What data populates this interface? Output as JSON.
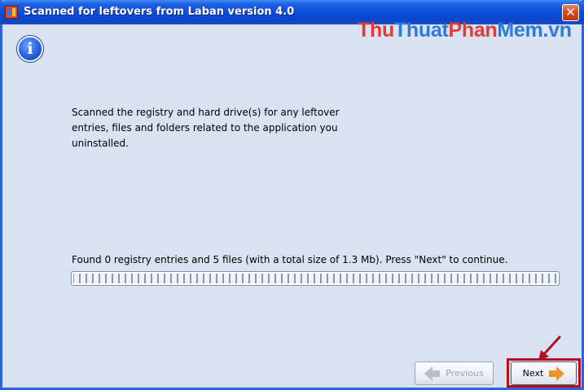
{
  "window": {
    "title": "Scanned for leftovers from Laban version 4.0",
    "close_label": "✕"
  },
  "watermark": {
    "part1": "Thu",
    "part2": "Thuat",
    "part3": "Phan",
    "part4": "Mem.vn"
  },
  "content": {
    "info_glyph": "i",
    "message": "Scanned the registry and hard drive(s) for any leftover entries, files and folders related to the application you uninstalled.",
    "found_text": "Found 0 registry entries and 5 files (with a total size of 1.3 Mb). Press \"Next\" to continue.",
    "progress_percent": 100
  },
  "buttons": {
    "previous_label": "Previous",
    "next_label": "Next"
  },
  "colors": {
    "titlebar": "#0a4ad8",
    "client_bg": "#d8e2f0",
    "highlight": "#b2101e",
    "next_arrow": "#f0922a"
  }
}
